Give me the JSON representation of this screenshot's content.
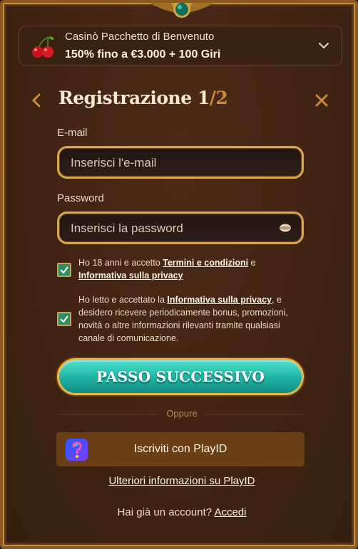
{
  "bonus": {
    "line1": "Casinò Pacchetto di Benvenuto",
    "line2": "150% fino a €3.000 + 100 Giri",
    "icon": "cherry-icon",
    "expand_icon": "chevron-down-icon"
  },
  "header": {
    "title": "Registrazione",
    "step_current": "1",
    "step_total": "/2",
    "back_icon": "chevron-left-icon",
    "close_icon": "close-icon"
  },
  "form": {
    "email_label": "E-mail",
    "email_placeholder": "Inserisci l'e-mail",
    "email_value": "",
    "password_label": "Password",
    "password_placeholder": "Inserisci la password",
    "password_value": "",
    "password_icon": "eye-icon"
  },
  "consents": [
    {
      "checked": true,
      "text_before": "Ho 18 anni e accetto ",
      "link1": "Termini e condizioni",
      "text_mid": " e ",
      "link2": "Informativa sulla privacy",
      "text_after": ""
    },
    {
      "checked": true,
      "text_before": "Ho letto e accettato la ",
      "link1": "Informativa sulla privacy",
      "text_after": ", e desidero ricevere periodicamente bonus, promozioni, novità o altre informazioni rilevanti tramite qualsiasi canale di comunicazione."
    }
  ],
  "actions": {
    "next_label": "PASSO SUCCESSIVO",
    "or_label": "Oppure",
    "playid_label": "Iscriviti con PlayID",
    "playid_icon": "playid-logo-icon",
    "more_info_label": "Ulteriori informazioni su PlayID",
    "login_prompt": "Hai già un account?",
    "login_link": "Accedi"
  },
  "colors": {
    "panel_bg": "#3f2314",
    "gold_border": "#d7a650",
    "primary_button": "#1fb7a6",
    "playid_button": "#6b3f16",
    "checkbox_fill": "#2e8f63",
    "step_total": "#c98a3d"
  }
}
